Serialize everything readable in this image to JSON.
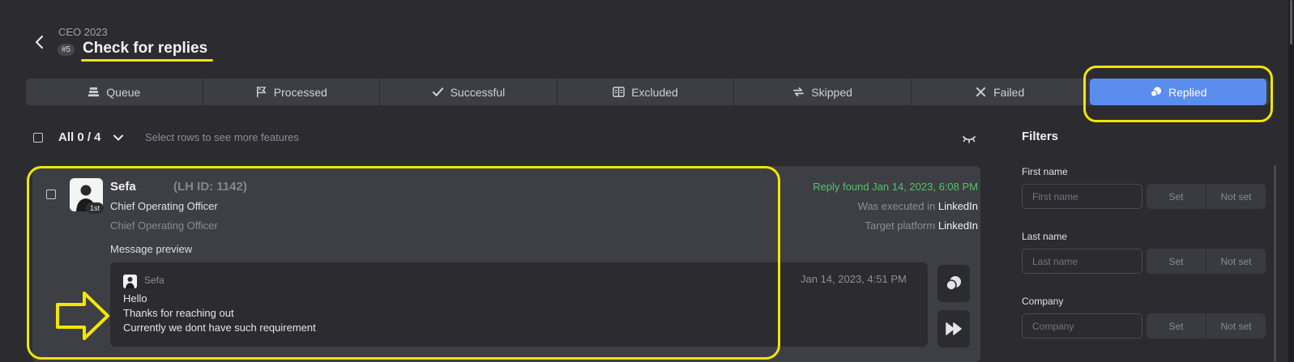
{
  "header": {
    "subtitle": "CEO 2023",
    "step_badge": "#5",
    "title": "Check for replies"
  },
  "tabs": [
    {
      "label": "Queue",
      "icon": "stack-icon"
    },
    {
      "label": "Processed",
      "icon": "flag-icon"
    },
    {
      "label": "Successful",
      "icon": "check-icon"
    },
    {
      "label": "Excluded",
      "icon": "excluded-icon"
    },
    {
      "label": "Skipped",
      "icon": "skip-arrows-icon"
    },
    {
      "label": "Failed",
      "icon": "x-icon"
    },
    {
      "label": "Replied",
      "icon": "chat-bubbles-icon",
      "active": true
    }
  ],
  "toolbar": {
    "all_label": "All 0 / 4",
    "hint": "Select rows to see more features"
  },
  "lead": {
    "name": "Sefa",
    "lh_id": "(LH ID: 1142)",
    "degree": "1st",
    "role": "Chief Operating Officer",
    "role_secondary": "Chief Operating Officer",
    "reply_found": "Reply found Jan 14, 2023, 6:08 PM",
    "executed_label": "Was executed in",
    "executed_value": "LinkedIn",
    "platform_label": "Target platform",
    "platform_value": "LinkedIn",
    "preview_label": "Message preview",
    "message": {
      "sender": "Sefa",
      "time": "Jan 14, 2023, 4:51 PM",
      "lines": [
        "Hello",
        "Thanks for reaching out",
        "Currently we dont have such requirement"
      ]
    }
  },
  "filters": {
    "title": "Filters",
    "fields": [
      {
        "label": "First name",
        "placeholder": "First name",
        "set": "Set",
        "not_set": "Not set"
      },
      {
        "label": "Last name",
        "placeholder": "Last name",
        "set": "Set",
        "not_set": "Not set"
      },
      {
        "label": "Company",
        "placeholder": "Company",
        "set": "Set",
        "not_set": "Not set"
      }
    ]
  },
  "colors": {
    "accent": "#5b8def",
    "success": "#55c26a",
    "annotation": "#f1e600",
    "background": "#2b2b30"
  }
}
